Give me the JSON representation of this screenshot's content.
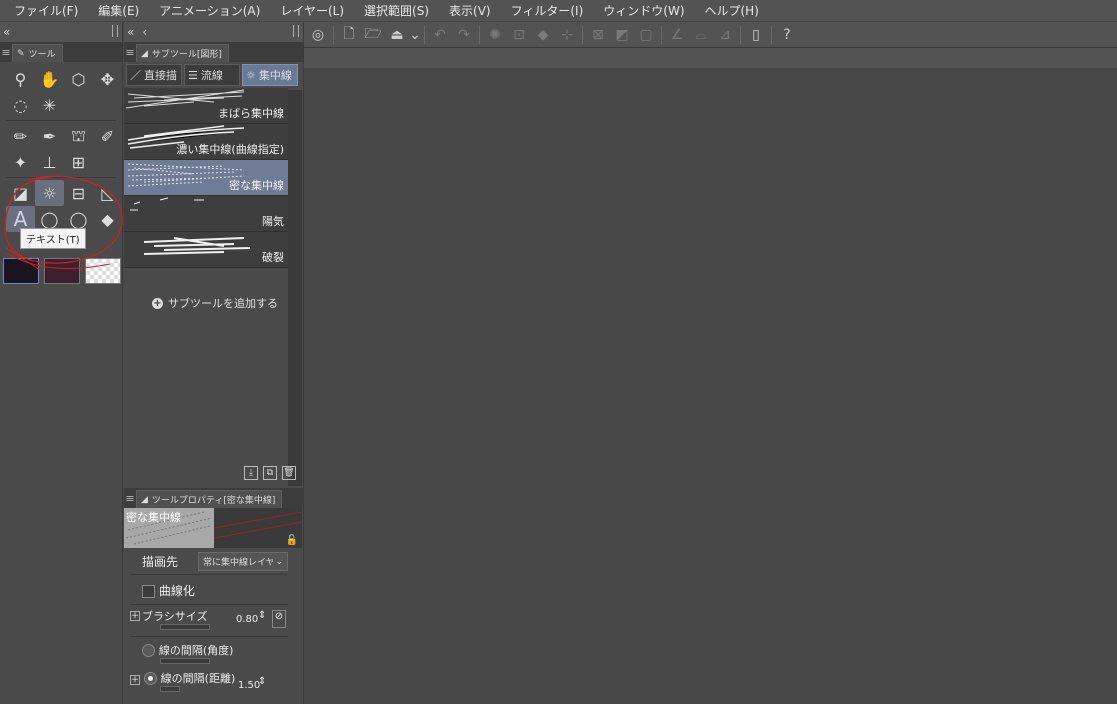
{
  "menu": [
    "ファイル(F)",
    "編集(E)",
    "アニメーション(A)",
    "レイヤー(L)",
    "選択範囲(S)",
    "表示(V)",
    "フィルター(I)",
    "ウィンドウ(W)",
    "ヘルプ(H)"
  ],
  "tool_panel": {
    "tab_label": "ツール",
    "tooltip": "テキスト(T)"
  },
  "subtool_panel": {
    "tab_label": "サブツール[図形]",
    "tabs": [
      "直接描",
      "流線",
      "集中線"
    ],
    "items": [
      {
        "label": "まばら集中線"
      },
      {
        "label": "濃い集中線(曲線指定)"
      },
      {
        "label": "密な集中線"
      },
      {
        "label": "陽気"
      },
      {
        "label": "破裂"
      }
    ],
    "add_label": "サブツールを追加する"
  },
  "property_panel": {
    "tab_label": "ツールプロパティ[密な集中線]",
    "preview_label": "密な集中線",
    "draw_target_label": "描画先",
    "draw_target_value": "常に集中線レイヤー",
    "curve_label": "曲線化",
    "brush_size_label": "ブラシサイズ",
    "brush_size_value": "0.80",
    "angle_spacing_label": "線の間隔(角度)",
    "distance_spacing_label": "線の間隔(距離)",
    "distance_spacing_value": "1.50"
  },
  "colors": {
    "selected_item": "#6f7c95",
    "annotation": "#d02020"
  }
}
